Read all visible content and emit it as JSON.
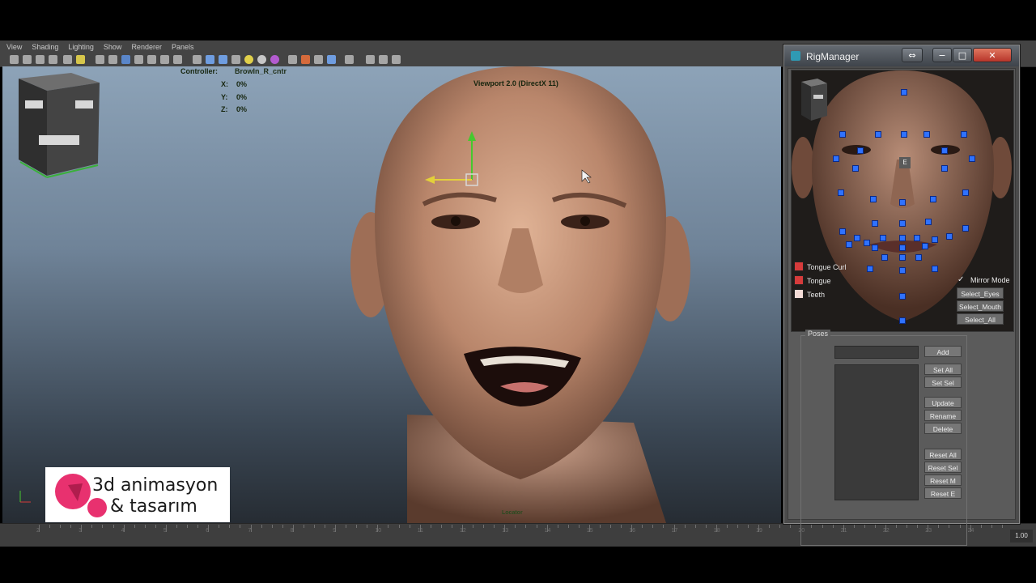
{
  "menu": [
    "View",
    "Shading",
    "Lighting",
    "Show",
    "Renderer",
    "Panels"
  ],
  "viewport": {
    "title": "Viewport 2.0 (DirectX 11)",
    "controller_label": "Controller:",
    "controller_name": "BrowIn_R_cntr",
    "x_label": "X:",
    "x_value": "0%",
    "y_label": "Y:",
    "y_value": "0%",
    "z_label": "Z:",
    "z_value": "0%",
    "bottom_label": "Locator"
  },
  "timeline": {
    "ticks": [
      "2",
      "3",
      "4",
      "5",
      "6",
      "7",
      "8",
      "9",
      "10",
      "11",
      "12",
      "13",
      "14",
      "15",
      "16",
      "17",
      "18",
      "19",
      "20",
      "21",
      "22",
      "23",
      "24"
    ],
    "current_time": "1.00"
  },
  "rig_manager": {
    "title": "RigManager",
    "face_marker": "E",
    "options": [
      {
        "label": "Tongue Curl",
        "color": "#d63b3b"
      },
      {
        "label": "Tongue",
        "color": "#d63b3b"
      },
      {
        "label": "Teeth",
        "color": "#f4dcd7"
      }
    ],
    "mirror_mode": "Mirror Mode",
    "select_buttons": [
      "Select_Eyes",
      "Select_Mouth",
      "Select_All"
    ],
    "poses_title": "Poses",
    "buttons": {
      "add": "Add",
      "set_all": "Set All",
      "set_sel": "Set Sel",
      "update": "Update",
      "rename": "Rename",
      "delete": "Delete",
      "reset_all": "Reset All",
      "reset_sel": "Reset Sel",
      "reset_m": "Reset M",
      "reset_e": "Reset E"
    }
  },
  "logo": {
    "line1": "3d animasyon",
    "line2": "& tasarım"
  }
}
